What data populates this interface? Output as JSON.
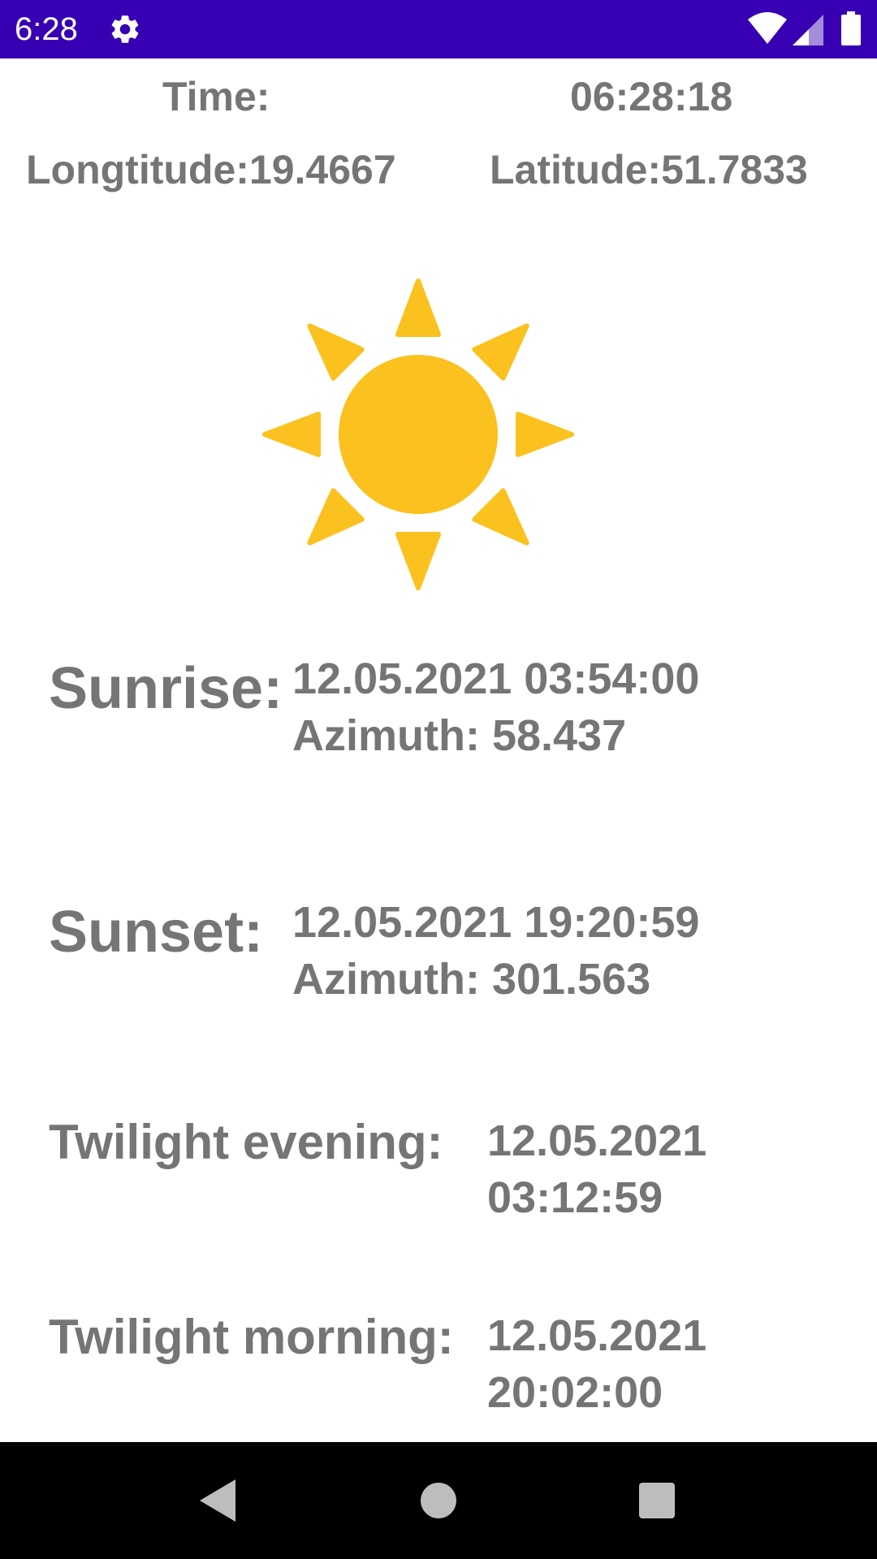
{
  "status_bar": {
    "time": "6:28",
    "icons": [
      "gear-icon",
      "wifi-icon",
      "signal-icon",
      "battery-icon"
    ],
    "color": "#3700b3"
  },
  "header": {
    "time_label": "Time:",
    "time_value": "06:28:18",
    "longitude": "Longtitude:19.4667",
    "latitude": "Latitude:51.7833"
  },
  "sun_icon": {
    "name": "sun-icon",
    "color": "#fbc11f"
  },
  "sunrise": {
    "label": "Sunrise:",
    "datetime": "12.05.2021 03:54:00",
    "azimuth": "Azimuth: 58.437"
  },
  "sunset": {
    "label": "Sunset:",
    "datetime": "12.05.2021 19:20:59",
    "azimuth": "Azimuth: 301.563"
  },
  "twilight_evening": {
    "label": "Twilight evening:",
    "date": "12.05.2021",
    "time": "03:12:59"
  },
  "twilight_morning": {
    "label": "Twilight morning:",
    "date": "12.05.2021",
    "time": "20:02:00"
  },
  "nav_bar": {
    "icons": [
      "back-icon",
      "home-icon",
      "recents-icon"
    ]
  },
  "colors": {
    "text": "#757575",
    "background": "#ffffff"
  }
}
